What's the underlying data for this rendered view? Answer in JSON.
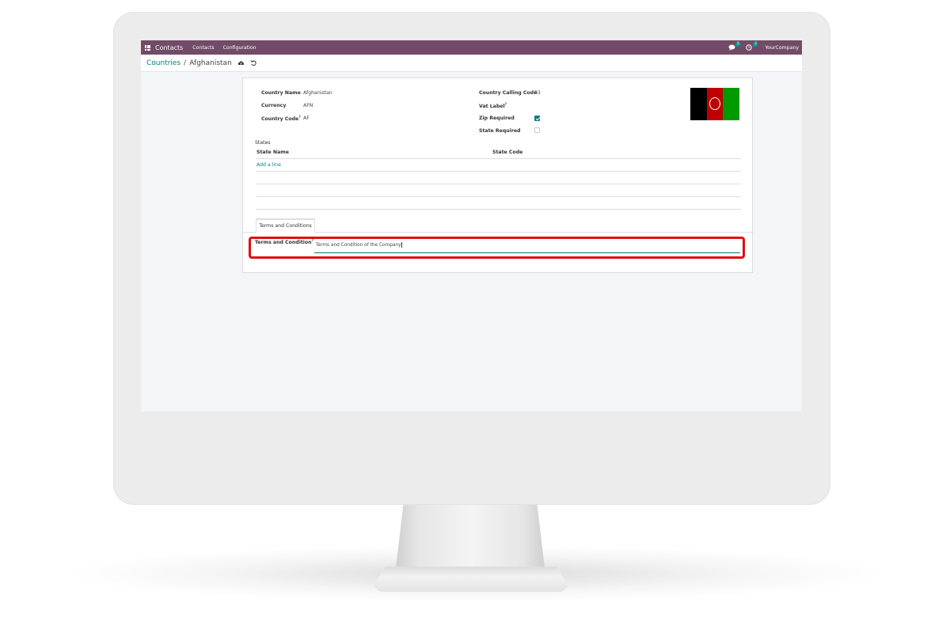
{
  "navbar": {
    "app_name": "Contacts",
    "menu": [
      "Contacts",
      "Configuration"
    ],
    "messages_badge": "5",
    "activity_badge": "3",
    "company": "YourCompany"
  },
  "breadcrumb": {
    "parent": "Countries",
    "separator": "/",
    "current": "Afghanistan"
  },
  "form": {
    "left_fields": [
      {
        "label": "Country Name",
        "value": "Afghanistan",
        "help": ""
      },
      {
        "label": "Currency",
        "value": "AFN",
        "help": ""
      },
      {
        "label": "Country Code",
        "value": "AF",
        "help": "?"
      }
    ],
    "right_fields": {
      "calling_code_label": "Country Calling Code",
      "calling_code_value": "93",
      "vat_label": "Vat Label",
      "vat_help": "?",
      "zip_label": "Zip Required",
      "zip_checked": true,
      "state_label": "State Required",
      "state_checked": false
    },
    "flag_colors": [
      "#000000",
      "#be0000",
      "#009900"
    ],
    "states": {
      "title": "States",
      "columns": [
        "State Name",
        "State Code"
      ],
      "add_line": "Add a line"
    },
    "tab_label": "Terms and Conditions",
    "terms": {
      "label": "Terms and Condition",
      "help": "?",
      "value": "Terms and Condition of the Company"
    }
  },
  "colors": {
    "navbar": "#714b67",
    "accent": "#017e84",
    "highlight": "#e01010"
  }
}
